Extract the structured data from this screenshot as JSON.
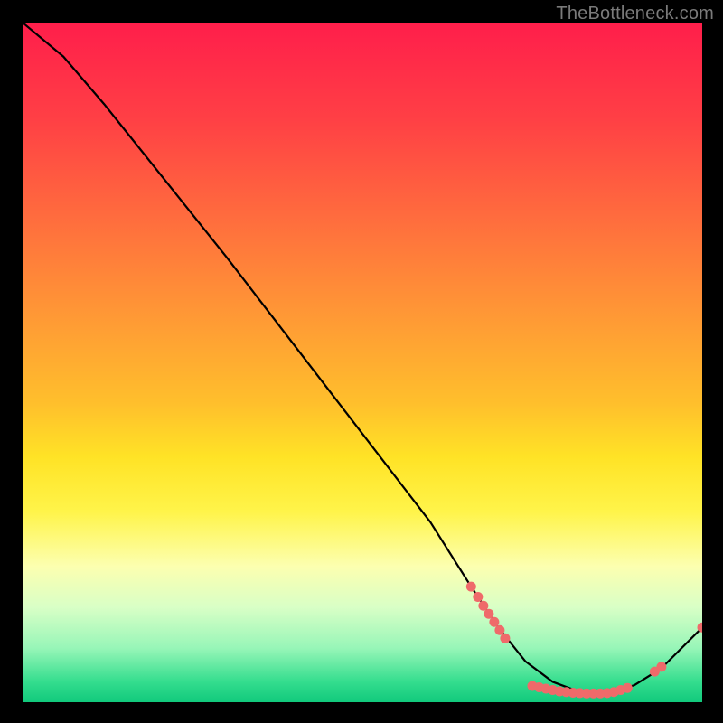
{
  "watermark": "TheBottleneck.com",
  "chart_data": {
    "type": "line",
    "title": "",
    "xlabel": "",
    "ylabel": "",
    "xlim": [
      0,
      100
    ],
    "ylim": [
      0,
      100
    ],
    "series": [
      {
        "name": "curve",
        "x": [
          0,
          6,
          12,
          20,
          30,
          40,
          50,
          60,
          66,
          70,
          74,
          78,
          82,
          86,
          90,
          94,
          100
        ],
        "y": [
          100,
          95,
          88,
          78,
          65.5,
          52.5,
          39.5,
          26.5,
          17,
          11,
          6,
          3,
          1.5,
          1.3,
          2.5,
          5,
          11
        ]
      }
    ],
    "markers": {
      "name": "dots",
      "color": "#ef6a6a",
      "points": [
        {
          "x": 66.0,
          "y": 17.0
        },
        {
          "x": 67.0,
          "y": 15.5
        },
        {
          "x": 67.8,
          "y": 14.2
        },
        {
          "x": 68.6,
          "y": 13.0
        },
        {
          "x": 69.4,
          "y": 11.8
        },
        {
          "x": 70.2,
          "y": 10.6
        },
        {
          "x": 71.0,
          "y": 9.4
        },
        {
          "x": 75.0,
          "y": 2.4
        },
        {
          "x": 76.0,
          "y": 2.2
        },
        {
          "x": 77.0,
          "y": 2.0
        },
        {
          "x": 78.0,
          "y": 1.8
        },
        {
          "x": 79.0,
          "y": 1.6
        },
        {
          "x": 80.0,
          "y": 1.5
        },
        {
          "x": 81.0,
          "y": 1.4
        },
        {
          "x": 82.0,
          "y": 1.35
        },
        {
          "x": 83.0,
          "y": 1.3
        },
        {
          "x": 84.0,
          "y": 1.3
        },
        {
          "x": 85.0,
          "y": 1.3
        },
        {
          "x": 86.0,
          "y": 1.35
        },
        {
          "x": 87.0,
          "y": 1.5
        },
        {
          "x": 88.0,
          "y": 1.8
        },
        {
          "x": 89.0,
          "y": 2.1
        },
        {
          "x": 93.0,
          "y": 4.5
        },
        {
          "x": 94.0,
          "y": 5.2
        },
        {
          "x": 100.0,
          "y": 11.0
        }
      ]
    }
  }
}
